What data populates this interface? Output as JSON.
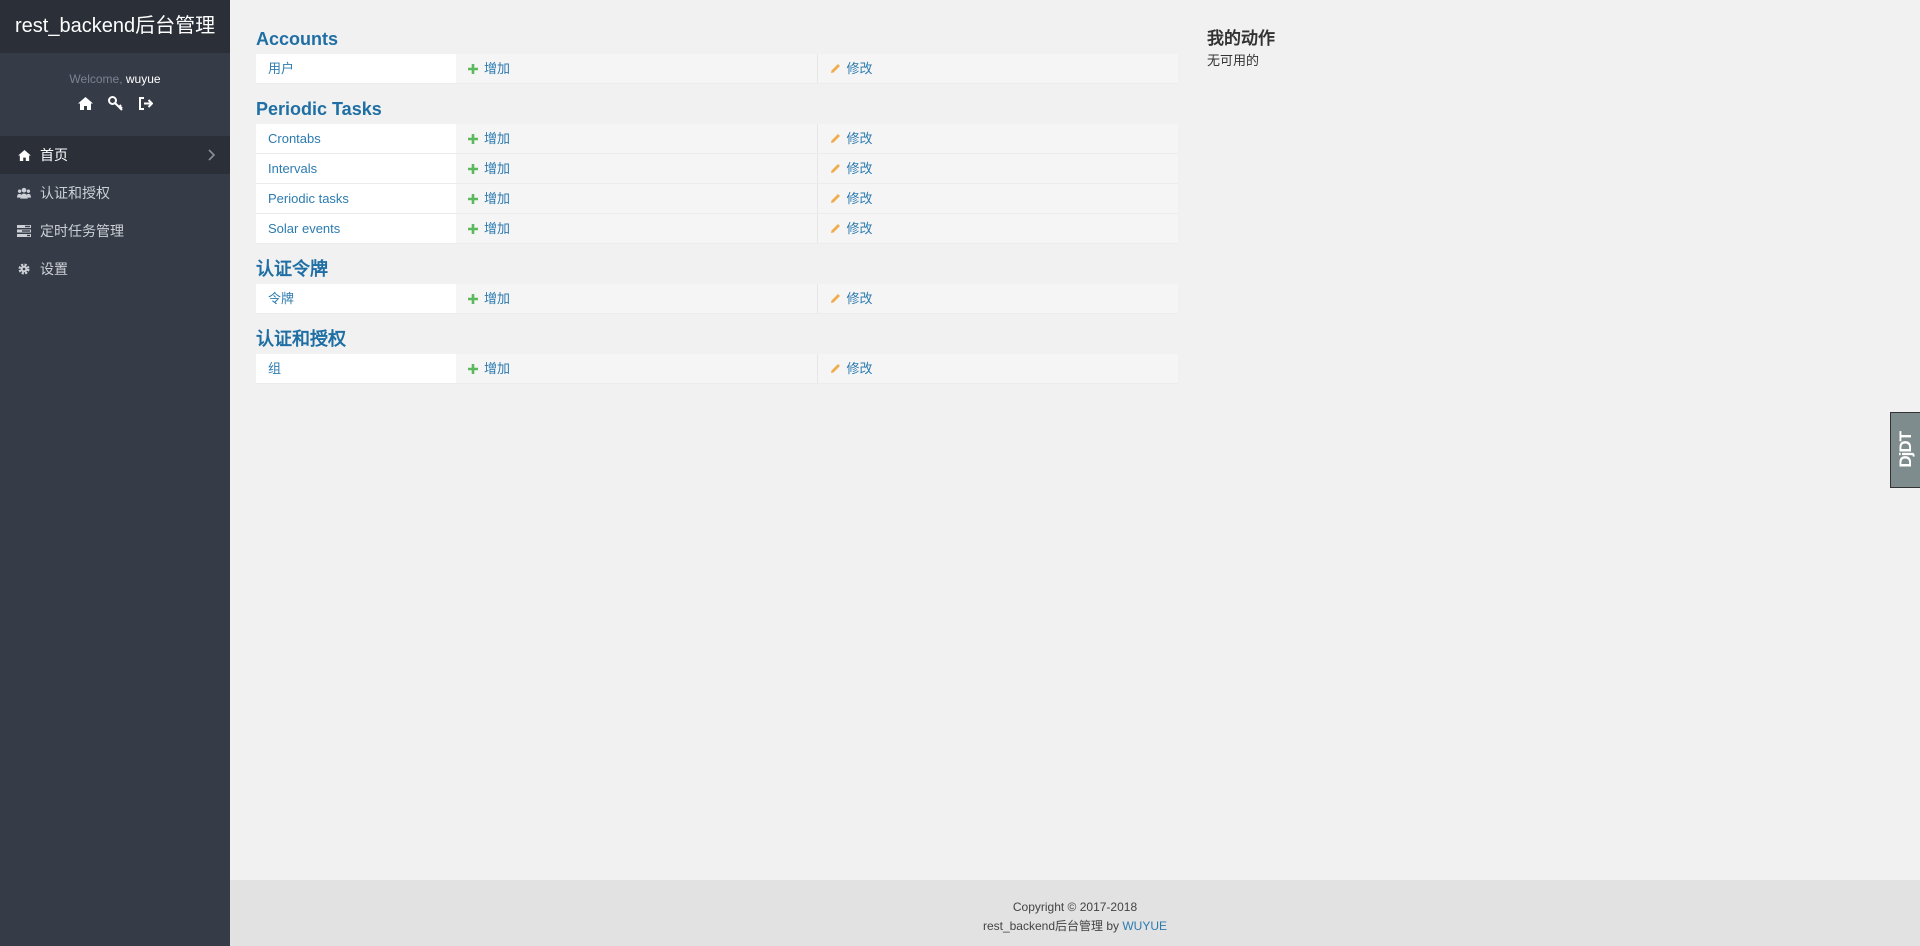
{
  "app": {
    "title": "rest_backend后台管理"
  },
  "user": {
    "welcome": "Welcome,",
    "name": "wuyue"
  },
  "user_icons": [
    "home-icon",
    "key-icon",
    "sign-out-icon"
  ],
  "sidebar": {
    "items": [
      {
        "label": "首页",
        "icon": "home-icon",
        "active": true
      },
      {
        "label": "认证和授权",
        "icon": "users-icon",
        "active": false
      },
      {
        "label": "定时任务管理",
        "icon": "tasks-icon",
        "active": false
      },
      {
        "label": "设置",
        "icon": "gear-icon",
        "active": false
      }
    ]
  },
  "modules": [
    {
      "title": "Accounts",
      "models": [
        {
          "name": "用户",
          "add": "增加",
          "change": "修改"
        }
      ]
    },
    {
      "title": "Periodic Tasks",
      "models": [
        {
          "name": "Crontabs",
          "add": "增加",
          "change": "修改"
        },
        {
          "name": "Intervals",
          "add": "增加",
          "change": "修改"
        },
        {
          "name": "Periodic tasks",
          "add": "增加",
          "change": "修改"
        },
        {
          "name": "Solar events",
          "add": "增加",
          "change": "修改"
        }
      ]
    },
    {
      "title": "认证令牌",
      "models": [
        {
          "name": "令牌",
          "add": "增加",
          "change": "修改"
        }
      ]
    },
    {
      "title": "认证和授权",
      "models": [
        {
          "name": "组",
          "add": "增加",
          "change": "修改"
        }
      ]
    }
  ],
  "actions": {
    "title": "我的动作",
    "empty": "无可用的"
  },
  "djdt": {
    "label": "DjDT"
  },
  "footer": {
    "copyright": "Copyright © 2017-2018",
    "by_prefix": "rest_backend后台管理 by",
    "author": "WUYUE"
  },
  "colors": {
    "sidebar_bg": "#363c47",
    "brand_bg": "#2b2f38",
    "link": "#2c7bb0",
    "add_icon": "#5cb85c",
    "change_icon": "#f0ad4e"
  }
}
